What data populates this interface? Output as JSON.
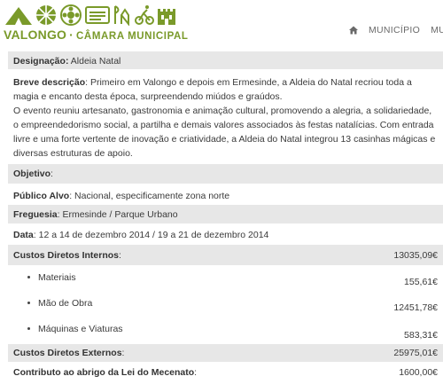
{
  "brand": {
    "name": "VALONGO",
    "separator": "·",
    "subtitle": "CÂMARA MUNICIPAL"
  },
  "nav": {
    "items": [
      "MUNICÍPIO",
      "MUNICÍ"
    ]
  },
  "fields": {
    "designacao_label": "Designação:",
    "designacao_value": " Aldeia Natal",
    "breve_label": "Breve descrição",
    "breve_value": ": Primeiro em Valongo e depois em Ermesinde, a Aldeia do Natal recriou toda a magia e encanto desta época, surpreendendo miúdos e graúdos.",
    "breve_value2": "O evento reuniu artesanato, gastronomia e animação cultural, promovendo a alegria, a solidariedade, o empreendedorismo social, a partilha e demais valores associados às festas natalícias. Com entrada livre e uma forte vertente de inovação e criatividade, a Aldeia do Natal integrou 13 casinhas mágicas e diversas estruturas de apoio.",
    "objetivo_label": "Objetivo",
    "objetivo_value": ":",
    "publico_label": "Público Alvo",
    "publico_value": ": Nacional, especificamente zona norte",
    "freguesia_label": "Freguesia",
    "freguesia_value": ": Ermesinde / Parque Urbano",
    "data_label": "Data",
    "data_value": ": 12 a 14 de dezembro 2014 / 19 a 21 de dezembro 2014"
  },
  "costs": {
    "internos_label": "Custos Diretos Internos",
    "internos_colon": ":",
    "internos_value": "13035,09€",
    "items": [
      {
        "label": "Materiais",
        "value": "155,61€"
      },
      {
        "label": "Mão de Obra",
        "value": "12451,78€"
      },
      {
        "label": "Máquinas e Viaturas",
        "value": "583,31€"
      }
    ],
    "externos_label": "Custos Diretos Externos",
    "externos_colon": ":",
    "externos_value": "25975,01€",
    "mecenato_label": "Contributo ao abrigo da Lei do Mecenato",
    "mecenato_colon": ":",
    "mecenato_value": "1600,00€"
  },
  "colors": {
    "brand_green": "#7a9a2a",
    "row_shade": "#e7e7e7"
  }
}
